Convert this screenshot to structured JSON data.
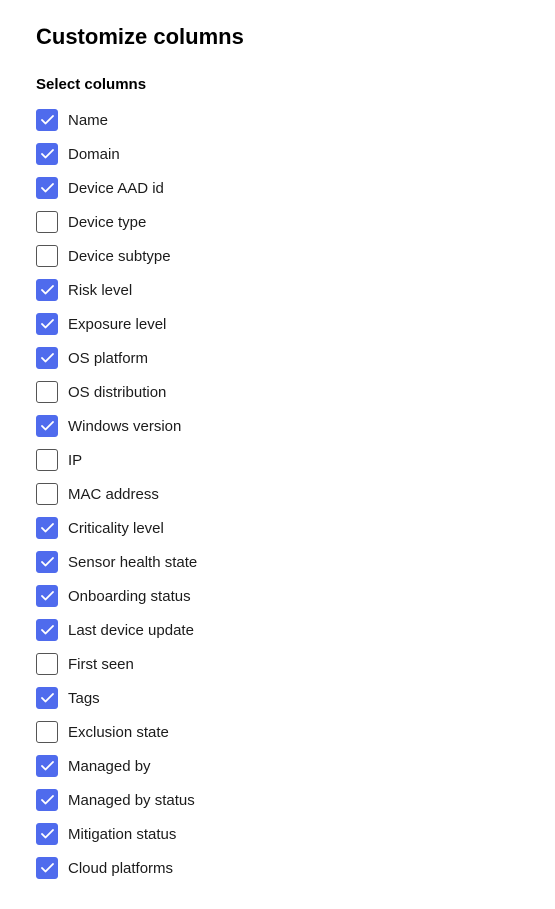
{
  "title": "Customize columns",
  "section_label": "Select columns",
  "columns": [
    {
      "id": "name",
      "label": "Name",
      "checked": true
    },
    {
      "id": "domain",
      "label": "Domain",
      "checked": true
    },
    {
      "id": "device-aad-id",
      "label": "Device AAD id",
      "checked": true
    },
    {
      "id": "device-type",
      "label": "Device type",
      "checked": false
    },
    {
      "id": "device-subtype",
      "label": "Device subtype",
      "checked": false
    },
    {
      "id": "risk-level",
      "label": "Risk level",
      "checked": true
    },
    {
      "id": "exposure-level",
      "label": "Exposure level",
      "checked": true
    },
    {
      "id": "os-platform",
      "label": "OS platform",
      "checked": true
    },
    {
      "id": "os-distribution",
      "label": "OS distribution",
      "checked": false
    },
    {
      "id": "windows-version",
      "label": "Windows version",
      "checked": true
    },
    {
      "id": "ip",
      "label": "IP",
      "checked": false
    },
    {
      "id": "mac-address",
      "label": "MAC address",
      "checked": false
    },
    {
      "id": "criticality-level",
      "label": "Criticality level",
      "checked": true
    },
    {
      "id": "sensor-health-state",
      "label": "Sensor health state",
      "checked": true
    },
    {
      "id": "onboarding-status",
      "label": "Onboarding status",
      "checked": true
    },
    {
      "id": "last-device-update",
      "label": "Last device update",
      "checked": true
    },
    {
      "id": "first-seen",
      "label": "First seen",
      "checked": false
    },
    {
      "id": "tags",
      "label": "Tags",
      "checked": true
    },
    {
      "id": "exclusion-state",
      "label": "Exclusion state",
      "checked": false
    },
    {
      "id": "managed-by",
      "label": "Managed by",
      "checked": true
    },
    {
      "id": "managed-by-status",
      "label": "Managed by status",
      "checked": true
    },
    {
      "id": "mitigation-status",
      "label": "Mitigation status",
      "checked": true
    },
    {
      "id": "cloud-platforms",
      "label": "Cloud platforms",
      "checked": true
    }
  ],
  "colors": {
    "checkbox_checked_bg": "#4f6bed",
    "checkbox_border": "#555555"
  }
}
